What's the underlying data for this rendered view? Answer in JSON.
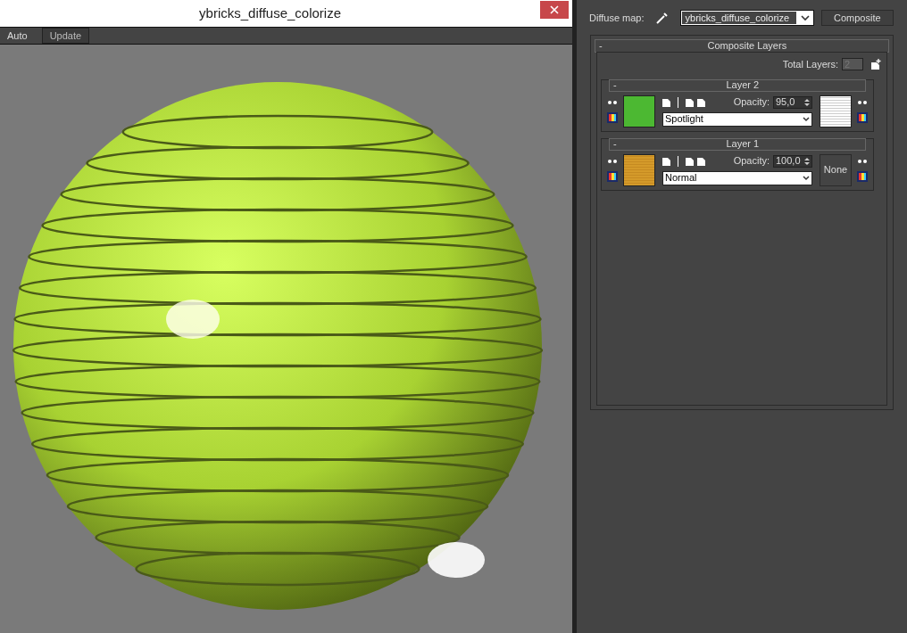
{
  "window": {
    "title": "ybricks_diffuse_colorize"
  },
  "toolbar": {
    "auto_label": "Auto",
    "update_button": "Update"
  },
  "material": {
    "label": "Diffuse map:",
    "map_name": "ybricks_diffuse_colorize",
    "type_button": "Composite"
  },
  "rollout": {
    "collapse": "-",
    "title": "Composite Layers",
    "total_label": "Total Layers:",
    "total_value": "2"
  },
  "layers": [
    {
      "collapse": "-",
      "title": "Layer 2",
      "swatch": {
        "kind": "color",
        "color": "#4cb832"
      },
      "opacity_label": "Opacity:",
      "opacity": "95,0",
      "blend_mode": "Spotlight",
      "mask": {
        "kind": "texture"
      }
    },
    {
      "collapse": "-",
      "title": "Layer 1",
      "swatch": {
        "kind": "texture"
      },
      "opacity_label": "Opacity:",
      "opacity": "100,0",
      "blend_mode": "Normal",
      "mask": {
        "kind": "none",
        "label": "None"
      }
    }
  ]
}
